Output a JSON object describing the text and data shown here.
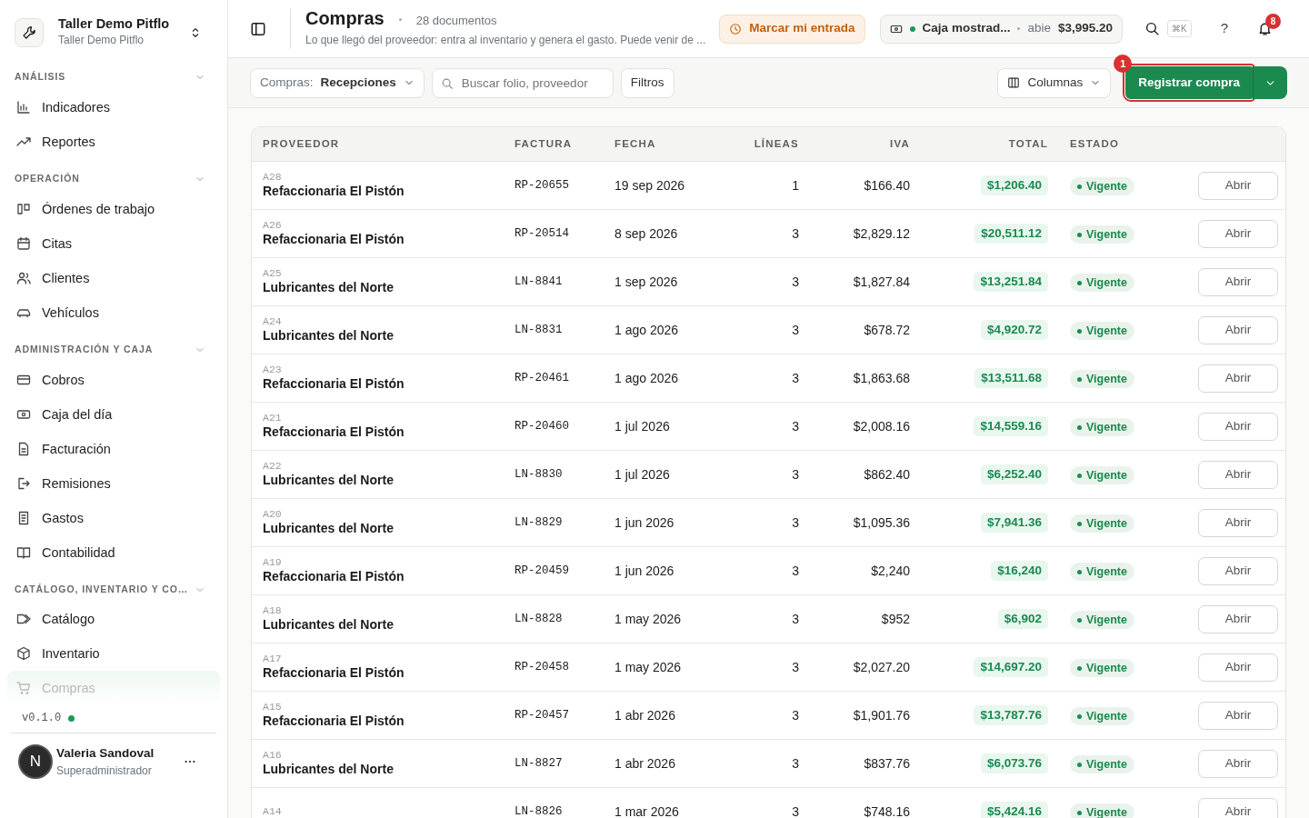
{
  "workspace": {
    "name": "Taller Demo Pitflo",
    "subtitle": "Taller Demo Pitflo"
  },
  "sidebar": {
    "groups": [
      {
        "title": "ANÁLISIS",
        "expanded": true,
        "items": [
          {
            "label": "Indicadores",
            "selected": false
          },
          {
            "label": "Reportes",
            "selected": false
          }
        ]
      },
      {
        "title": "OPERACIÓN",
        "expanded": true,
        "items": [
          {
            "label": "Órdenes de trabajo",
            "selected": false
          },
          {
            "label": "Citas",
            "selected": false
          },
          {
            "label": "Clientes",
            "selected": false
          },
          {
            "label": "Vehículos",
            "selected": false
          }
        ]
      },
      {
        "title": "ADMINISTRACIÓN Y CAJA",
        "expanded": true,
        "items": [
          {
            "label": "Cobros",
            "selected": false
          },
          {
            "label": "Caja del día",
            "selected": false
          },
          {
            "label": "Facturación",
            "selected": false
          },
          {
            "label": "Remisiones",
            "selected": false
          },
          {
            "label": "Gastos",
            "selected": false
          },
          {
            "label": "Contabilidad",
            "selected": false
          }
        ]
      },
      {
        "title": "CATÁLOGO, INVENTARIO Y CO…",
        "expanded": true,
        "items": [
          {
            "label": "Catálogo",
            "selected": false
          },
          {
            "label": "Inventario",
            "selected": false
          },
          {
            "label": "Compras",
            "selected": true
          }
        ]
      }
    ],
    "version": "v0.1.0",
    "user": {
      "initial": "N",
      "name": "Valeria Sandoval",
      "role": "Superadministrador"
    }
  },
  "header": {
    "title": "Compras",
    "count": "28 documentos",
    "subtitle": "Lo que llegó del proveedor: entra al inventario y genera el gasto. Puede venir de ...",
    "clock_in": "Marcar mi entrada",
    "cash": {
      "name": "Caja mostrad...",
      "state": "abie",
      "amount": "$3,995.20"
    },
    "shortcut": "⌘K",
    "help": "?",
    "notifications": "8"
  },
  "toolbar": {
    "filter_label": "Compras:",
    "filter_value": "Recepciones",
    "search": {
      "placeholder": "Buscar folio, proveedor"
    },
    "filters": "Filtros",
    "columns": "Columnas",
    "primary": "Registrar compra",
    "step": "1"
  },
  "table": {
    "columns": [
      "PROVEEDOR",
      "FACTURA",
      "FECHA",
      "LÍNEAS",
      "IVA",
      "TOTAL",
      "ESTADO"
    ],
    "rows": [
      {
        "code": "A28",
        "supplier": "Refaccionaria El Pistón",
        "invoice": "RP-20655",
        "date": "19 sep 2026",
        "lines": "1",
        "iva": "$166.40",
        "total": "$1,206.40",
        "status": "Vigente",
        "action": "Abrir"
      },
      {
        "code": "A26",
        "supplier": "Refaccionaria El Pistón",
        "invoice": "RP-20514",
        "date": "8 sep 2026",
        "lines": "3",
        "iva": "$2,829.12",
        "total": "$20,511.12",
        "status": "Vigente",
        "action": "Abrir"
      },
      {
        "code": "A25",
        "supplier": "Lubricantes del Norte",
        "invoice": "LN-8841",
        "date": "1 sep 2026",
        "lines": "3",
        "iva": "$1,827.84",
        "total": "$13,251.84",
        "status": "Vigente",
        "action": "Abrir"
      },
      {
        "code": "A24",
        "supplier": "Lubricantes del Norte",
        "invoice": "LN-8831",
        "date": "1 ago 2026",
        "lines": "3",
        "iva": "$678.72",
        "total": "$4,920.72",
        "status": "Vigente",
        "action": "Abrir"
      },
      {
        "code": "A23",
        "supplier": "Refaccionaria El Pistón",
        "invoice": "RP-20461",
        "date": "1 ago 2026",
        "lines": "3",
        "iva": "$1,863.68",
        "total": "$13,511.68",
        "status": "Vigente",
        "action": "Abrir"
      },
      {
        "code": "A21",
        "supplier": "Refaccionaria El Pistón",
        "invoice": "RP-20460",
        "date": "1 jul 2026",
        "lines": "3",
        "iva": "$2,008.16",
        "total": "$14,559.16",
        "status": "Vigente",
        "action": "Abrir"
      },
      {
        "code": "A22",
        "supplier": "Lubricantes del Norte",
        "invoice": "LN-8830",
        "date": "1 jul 2026",
        "lines": "3",
        "iva": "$862.40",
        "total": "$6,252.40",
        "status": "Vigente",
        "action": "Abrir"
      },
      {
        "code": "A20",
        "supplier": "Lubricantes del Norte",
        "invoice": "LN-8829",
        "date": "1 jun 2026",
        "lines": "3",
        "iva": "$1,095.36",
        "total": "$7,941.36",
        "status": "Vigente",
        "action": "Abrir"
      },
      {
        "code": "A19",
        "supplier": "Refaccionaria El Pistón",
        "invoice": "RP-20459",
        "date": "1 jun 2026",
        "lines": "3",
        "iva": "$2,240",
        "total": "$16,240",
        "status": "Vigente",
        "action": "Abrir"
      },
      {
        "code": "A18",
        "supplier": "Lubricantes del Norte",
        "invoice": "LN-8828",
        "date": "1 may 2026",
        "lines": "3",
        "iva": "$952",
        "total": "$6,902",
        "status": "Vigente",
        "action": "Abrir"
      },
      {
        "code": "A17",
        "supplier": "Refaccionaria El Pistón",
        "invoice": "RP-20458",
        "date": "1 may 2026",
        "lines": "3",
        "iva": "$2,027.20",
        "total": "$14,697.20",
        "status": "Vigente",
        "action": "Abrir"
      },
      {
        "code": "A15",
        "supplier": "Refaccionaria El Pistón",
        "invoice": "RP-20457",
        "date": "1 abr 2026",
        "lines": "3",
        "iva": "$1,901.76",
        "total": "$13,787.76",
        "status": "Vigente",
        "action": "Abrir"
      },
      {
        "code": "A16",
        "supplier": "Lubricantes del Norte",
        "invoice": "LN-8827",
        "date": "1 abr 2026",
        "lines": "3",
        "iva": "$837.76",
        "total": "$6,073.76",
        "status": "Vigente",
        "action": "Abrir"
      },
      {
        "code": "A14",
        "invoice": "LN-8826",
        "date": "1 mar 2026",
        "lines": "3",
        "iva": "$748.16",
        "total": "$5,424.16",
        "status": "Vigente",
        "action": "Abrir"
      }
    ]
  }
}
